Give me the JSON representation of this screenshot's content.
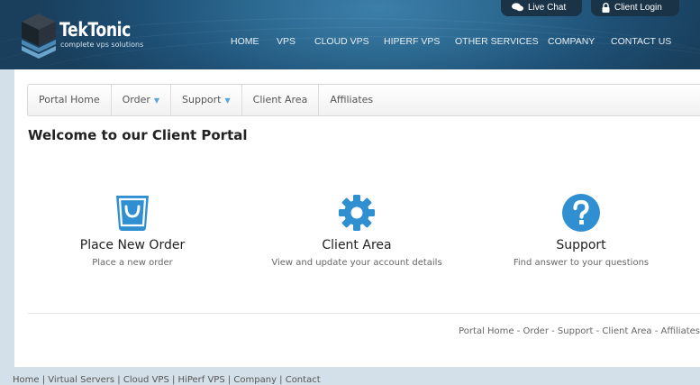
{
  "brand": {
    "name": "TekTonic",
    "tagline": "complete vps solutions",
    "header_color": "#245a80"
  },
  "top_buttons": {
    "live_chat": "Live Chat",
    "client_login": "Client Login"
  },
  "main_nav": [
    "HOME",
    "VPS",
    "CLOUD VPS",
    "HIPERF VPS",
    "OTHER SERVICES",
    "COMPANY",
    "CONTACT US"
  ],
  "sub_nav": {
    "portal_home": "Portal Home",
    "order": "Order",
    "support": "Support",
    "client_area": "Client Area",
    "affiliates": "Affiliates",
    "caret": "▼"
  },
  "page": {
    "title": "Welcome to our Client Portal"
  },
  "cards": [
    {
      "title": "Place New Order",
      "subtitle": "Place a new order",
      "icon": "shopping-bag-icon"
    },
    {
      "title": "Client Area",
      "subtitle": "View and update your account details",
      "icon": "gear-icon"
    },
    {
      "title": "Support",
      "subtitle": "Find answer to your questions",
      "icon": "question-circle-icon"
    }
  ],
  "footer": {
    "links": "Portal Home - Order - Support - Client Area - Affiliates"
  },
  "bottom_links": "Home | Virtual Servers | Cloud VPS | HiPerf VPS | Company | Contact",
  "colors": {
    "accent": "#2f8fd0",
    "background": "#d3e0e9"
  }
}
